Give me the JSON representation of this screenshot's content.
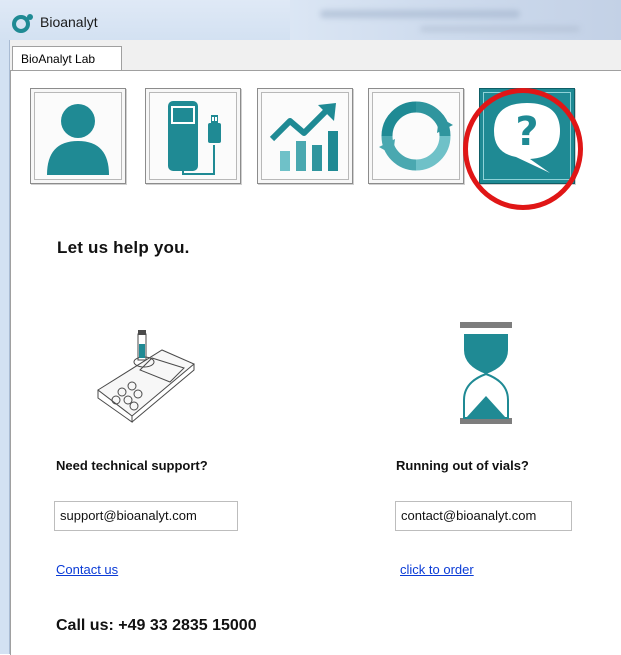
{
  "window": {
    "title": "Bioanalyt"
  },
  "tabs": [
    {
      "label": "BioAnalyt Lab"
    }
  ],
  "toolbar": {
    "tiles": [
      {
        "icon": "user-icon"
      },
      {
        "icon": "device-connect-icon"
      },
      {
        "icon": "chart-growth-icon"
      },
      {
        "icon": "refresh-icon"
      },
      {
        "icon": "help-speech-bubble-icon",
        "active": true
      }
    ]
  },
  "main": {
    "heading": "Let us help you.",
    "technical": {
      "label": "Need technical support?",
      "email": "support@bioanalyt.com",
      "link": "Contact us"
    },
    "vials": {
      "label": "Running out of vials?",
      "email": "contact@bioanalyt.com",
      "link": "click to order"
    },
    "phone": "Call us: +49 33 2835 15000"
  },
  "colors": {
    "teal": "#1f8a94",
    "highlight": "#e01616",
    "link": "#0a3bd6"
  }
}
